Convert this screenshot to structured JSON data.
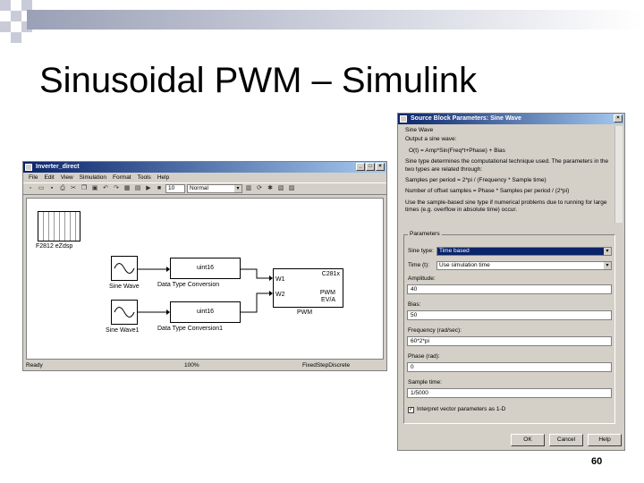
{
  "slide": {
    "title": "Sinusoidal PWM – Simulink",
    "page_number": "60"
  },
  "model_window": {
    "title": "Inverter_direct",
    "menu": [
      "File",
      "Edit",
      "View",
      "Simulation",
      "Format",
      "Tools",
      "Help"
    ],
    "stop_time": "10",
    "sim_mode": "Normal",
    "status_left": "Ready",
    "status_zoom": "100%",
    "status_solver": "FixedStepDiscrete",
    "blocks": {
      "f2812_label": "F2812 eZdsp",
      "sine1_label": "Sine Wave",
      "sine2_label": "Sine Wave1",
      "conv1_text": "uint16",
      "conv1_label": "Data Type Conversion",
      "conv2_text": "uint16",
      "conv2_label": "Data Type Conversion1",
      "pwm_title": "C281x",
      "pwm_port1": "W1",
      "pwm_port2": "W2",
      "pwm_name": "PWM",
      "pwm_sub": "EV/A",
      "pwm_block_label": "PWM"
    }
  },
  "dialog": {
    "title": "Source Block Parameters: Sine Wave",
    "section_title": "Sine Wave",
    "description": [
      "Output a sine wave:",
      "O(t) = Amp*Sin(Freq*t+Phase) + Bias",
      "Sine type determines the computational technique used. The parameters in the two types are related through:",
      "Samples per period = 2*pi / (Frequency * Sample time)",
      "Number of offset samples = Phase * Samples per period / (2*pi)",
      "Use the sample-based sine type if numerical problems due to running for large times (e.g. overflow in absolute time) occur."
    ],
    "parameters_title": "Parameters",
    "sine_type_label": "Sine type:",
    "sine_type_value": "Time based",
    "time_label": "Time (t):",
    "time_value": "Use simulation time",
    "amplitude_label": "Amplitude:",
    "amplitude_value": "40",
    "bias_label": "Bias:",
    "bias_value": "50",
    "frequency_label": "Frequency (rad/sec):",
    "frequency_value": "60*2*pi",
    "phase_label": "Phase (rad):",
    "phase_value": "0",
    "sample_time_label": "Sample time:",
    "sample_time_value": "1/5000",
    "interpret_label": "Interpret vector parameters as 1-D",
    "interpret_checked": true,
    "ok_label": "OK",
    "cancel_label": "Cancel",
    "help_label": "Help"
  },
  "colors": {
    "titlebar": "#0a246a",
    "window_bg": "#d4d0c8"
  }
}
